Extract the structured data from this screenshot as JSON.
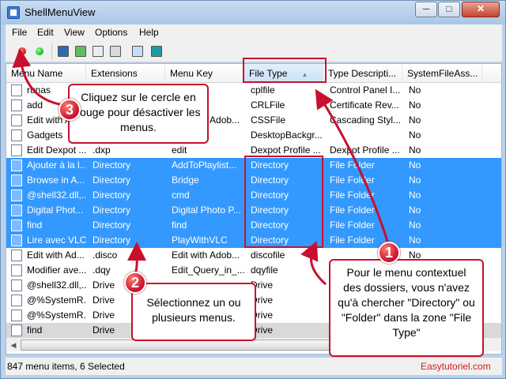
{
  "window": {
    "title": "ShellMenuView",
    "min_label": "─",
    "max_label": "□",
    "close_label": "✕"
  },
  "menu": [
    "File",
    "Edit",
    "View",
    "Options",
    "Help"
  ],
  "columns": [
    "Menu Name",
    "Extensions",
    "Menu Key",
    "File Type",
    "Type Descripti...",
    "SystemFileAss..."
  ],
  "sorted_column": "File Type",
  "rows": [
    {
      "name": "runas",
      "ext": "",
      "key": "",
      "type": "cplfile",
      "desc": "Control Panel I...",
      "sys": "No",
      "state": "normal"
    },
    {
      "name": "add",
      "ext": "",
      "key": "",
      "type": "CRLFile",
      "desc": "Certificate Rev...",
      "sys": "No",
      "state": "normal"
    },
    {
      "name": "Edit with A",
      "ext": "",
      "key": "Edit with Adob...",
      "type": "CSSFile",
      "desc": "Cascading Styl...",
      "sys": "No",
      "state": "normal"
    },
    {
      "name": "Gadgets",
      "ext": "",
      "key": "",
      "type": "DesktopBackgr...",
      "desc": "",
      "sys": "No",
      "state": "normal"
    },
    {
      "name": "Edit Dexpot ...",
      "ext": ".dxp",
      "key": "edit",
      "type": "Dexpot Profile ...",
      "desc": "Dexpot Profile ...",
      "sys": "No",
      "state": "normal"
    },
    {
      "name": "Ajouter à la l...",
      "ext": "Directory",
      "key": "AddToPlaylist...",
      "type": "Directory",
      "desc": "File Folder",
      "sys": "No",
      "state": "selected"
    },
    {
      "name": "Browse in A...",
      "ext": "Directory",
      "key": "Bridge",
      "type": "Directory",
      "desc": "File Folder",
      "sys": "No",
      "state": "selected"
    },
    {
      "name": "@shell32.dll,...",
      "ext": "Directory",
      "key": "cmd",
      "type": "Directory",
      "desc": "File Folder",
      "sys": "No",
      "state": "selected"
    },
    {
      "name": "Digital Phot...",
      "ext": "Directory",
      "key": "Digital Photo P...",
      "type": "Directory",
      "desc": "File Folder",
      "sys": "No",
      "state": "selected"
    },
    {
      "name": "find",
      "ext": "Directory",
      "key": "find",
      "type": "Directory",
      "desc": "File Folder",
      "sys": "No",
      "state": "selected"
    },
    {
      "name": "Lire avec VLC",
      "ext": "Directory",
      "key": "PlayWithVLC",
      "type": "Directory",
      "desc": "File Folder",
      "sys": "No",
      "state": "selected"
    },
    {
      "name": "Edit with Ad...",
      "ext": ".disco",
      "key": "Edit with Adob...",
      "type": "discofile",
      "desc": "",
      "sys": "No",
      "state": "normal"
    },
    {
      "name": "Modifier ave...",
      "ext": ".dqy",
      "key": "Edit_Query_in_...",
      "type": "dqyfile",
      "desc": "",
      "sys": "No",
      "state": "normal"
    },
    {
      "name": "@shell32.dll,...",
      "ext": "Drive",
      "key": "",
      "type": "Drive",
      "desc": "",
      "sys": "No",
      "state": "normal"
    },
    {
      "name": "@%SystemR...",
      "ext": "Drive",
      "key": "",
      "type": "Drive",
      "desc": "",
      "sys": "No",
      "state": "normal"
    },
    {
      "name": "@%SystemR...",
      "ext": "Drive",
      "key": "",
      "type": "Drive",
      "desc": "",
      "sys": "No",
      "state": "normal"
    },
    {
      "name": "find",
      "ext": "Drive",
      "key": "",
      "type": "Drive",
      "desc": "",
      "sys": "No",
      "state": "inactive"
    }
  ],
  "status": {
    "text": "847 menu items, 6 Selected",
    "brand": "Easytutoriel.com"
  },
  "callouts": {
    "c1": {
      "number": "1",
      "text": "Pour le menu contextuel des dossiers, vous n'avez qu'à chercher \"Directory\" ou \"Folder\" dans la zone \"File Type\""
    },
    "c2": {
      "number": "2",
      "text": "Sélectionnez un ou plusieurs menus."
    },
    "c3": {
      "number": "3",
      "text": "Cliquez sur le cercle en rouge pour désactiver les menus."
    }
  },
  "colors": {
    "selection": "#3399ff",
    "annotation": "#c8102e",
    "disable_dot": "#e01010",
    "enable_dot": "#11c011"
  },
  "toolbar_icons": [
    "disable-dot-icon",
    "enable-dot-icon",
    "save-icon",
    "refresh-icon",
    "copy-icon",
    "properties-icon",
    "find-icon",
    "exit-icon"
  ]
}
